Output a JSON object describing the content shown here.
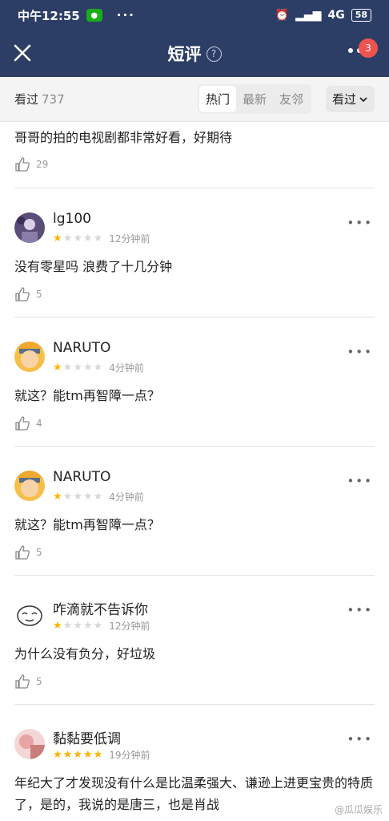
{
  "status": {
    "time": "中午12:55",
    "dots": "···",
    "network": "4G",
    "battery": "58"
  },
  "nav": {
    "title": "短评",
    "help": "?",
    "badge": "3"
  },
  "filter": {
    "seen_label": "看过",
    "seen_count": "737",
    "tabs": [
      {
        "label": "热门"
      },
      {
        "label": "最新"
      },
      {
        "label": "友邻"
      }
    ],
    "viewed_button": "看过"
  },
  "partial": {
    "content": "哥哥的拍的电视剧都非常好看，好期待",
    "likes": "29"
  },
  "reviews": [
    {
      "name": "lg100",
      "stars": 1,
      "time": "12分钟前",
      "content": "没有零星吗 浪费了十几分钟",
      "likes": "5"
    },
    {
      "name": "NARUTO",
      "stars": 1,
      "time": "4分钟前",
      "content": "就这？能tm再智障一点？",
      "likes": "4"
    },
    {
      "name": "NARUTO",
      "stars": 1,
      "time": "4分钟前",
      "content": "就这？能tm再智障一点？",
      "likes": "5"
    },
    {
      "name": "咋滴就不告诉你",
      "stars": 1,
      "time": "12分钟前",
      "content": "为什么没有负分，好垃圾",
      "likes": "5"
    },
    {
      "name": "黏黏要低调",
      "stars": 5,
      "time": "19分钟前",
      "content": "年纪大了才发现没有什么是比温柔强大、谦逊上进更宝贵的特质了，是的，我说的是唐三，也是肖战",
      "likes": ""
    }
  ],
  "watermark": "@瓜瓜娱乐",
  "colors": {
    "nav_bg": "#2d3e66",
    "star_on": "#ffb300",
    "badge": "#ef5350"
  }
}
